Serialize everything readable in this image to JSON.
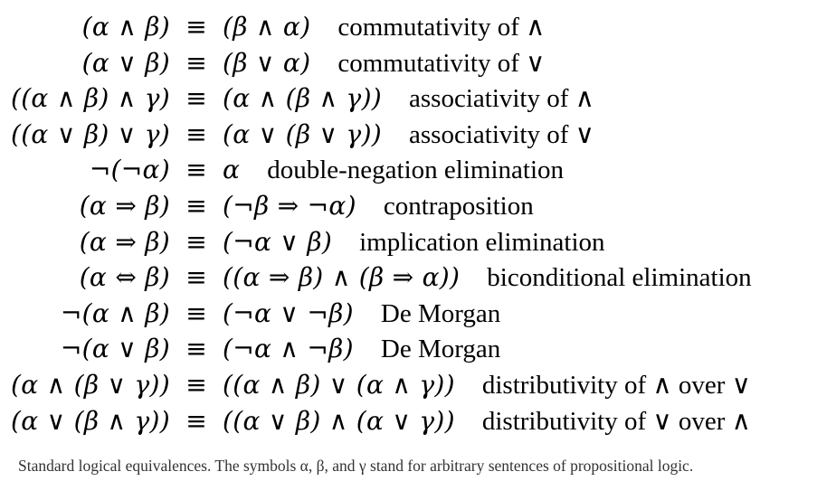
{
  "equivalences": [
    {
      "lhs": "(α ∧ β)",
      "equiv": "≡",
      "rhs": "(β ∧ α)",
      "description": "commutativity of ∧"
    },
    {
      "lhs": "(α ∨ β)",
      "equiv": "≡",
      "rhs": "(β ∨ α)",
      "description": "commutativity of ∨"
    },
    {
      "lhs": "((α ∧ β) ∧ γ)",
      "equiv": "≡",
      "rhs": "(α ∧ (β ∧ γ))",
      "description": "associativity of ∧"
    },
    {
      "lhs": "((α ∨ β) ∨ γ)",
      "equiv": "≡",
      "rhs": "(α ∨ (β ∨ γ))",
      "description": "associativity of ∨"
    },
    {
      "lhs": "¬(¬α)",
      "equiv": "≡",
      "rhs": "α",
      "description": "double-negation elimination"
    },
    {
      "lhs": "(α ⇒ β)",
      "equiv": "≡",
      "rhs": "(¬β ⇒ ¬α)",
      "description": "contraposition"
    },
    {
      "lhs": "(α ⇒ β)",
      "equiv": "≡",
      "rhs": "(¬α ∨ β)",
      "description": "implication elimination"
    },
    {
      "lhs": "(α ⇔ β)",
      "equiv": "≡",
      "rhs": "((α ⇒ β) ∧ (β ⇒ α))",
      "description": "biconditional elimination"
    },
    {
      "lhs": "¬(α ∧ β)",
      "equiv": "≡",
      "rhs": "(¬α ∨ ¬β)",
      "description": "De Morgan"
    },
    {
      "lhs": "¬(α ∨ β)",
      "equiv": "≡",
      "rhs": "(¬α ∧ ¬β)",
      "description": "De Morgan"
    },
    {
      "lhs": "(α ∧ (β ∨ γ))",
      "equiv": "≡",
      "rhs": "((α ∧ β) ∨ (α ∧ γ))",
      "description": "distributivity of ∧ over ∨"
    },
    {
      "lhs": "(α ∨ (β ∧ γ))",
      "equiv": "≡",
      "rhs": "((α ∨ β) ∧ (α ∨ γ))",
      "description": "distributivity of ∨ over ∧"
    }
  ],
  "caption": "Standard logical equivalences. The symbols α, β, and γ stand for arbitrary sentences of propositional logic."
}
